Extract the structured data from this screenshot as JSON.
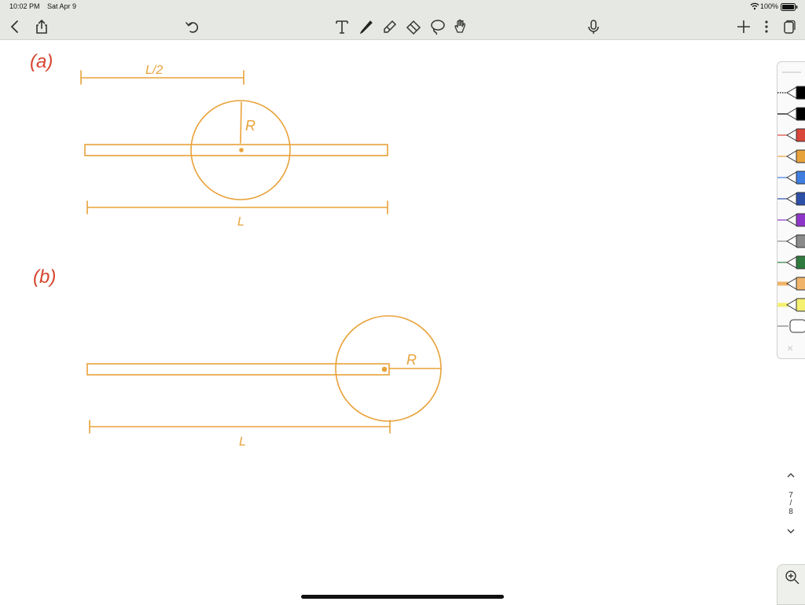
{
  "status": {
    "time": "10:02 PM",
    "date": "Sat Apr 9",
    "battery": "100%"
  },
  "toolbar": {
    "left": [
      "back-icon",
      "share-icon",
      "undo-icon"
    ],
    "tools": [
      "text-tool-icon",
      "pen-tool-icon",
      "highlighter-tool-icon",
      "eraser-tool-icon",
      "lasso-tool-icon",
      "hand-tool-icon"
    ],
    "center": [
      "microphone-icon"
    ],
    "right": [
      "add-icon",
      "more-icon",
      "pages-icon"
    ]
  },
  "note": {
    "part_a_label": "(a)",
    "half_length_label": "L/2",
    "radius_label_a": "R",
    "length_label_a": "L",
    "part_b_label": "(b)",
    "radius_label_b": "R",
    "length_label_b": "L"
  },
  "colors": {
    "ink_orange": "#e8a23a",
    "ink_red": "#d6452f",
    "toolbar_bg": "#e6e9e3"
  },
  "pen_palette": [
    {
      "name": "pen-black-dotted",
      "color": "#000000"
    },
    {
      "name": "pen-black",
      "color": "#000000"
    },
    {
      "name": "pen-red",
      "color": "#d9463a"
    },
    {
      "name": "pen-orange",
      "color": "#e8a23a"
    },
    {
      "name": "pen-blue",
      "color": "#3f7de0"
    },
    {
      "name": "pen-dark-blue",
      "color": "#2c4fa8"
    },
    {
      "name": "pen-purple",
      "color": "#8e35c9"
    },
    {
      "name": "pen-gray",
      "color": "#8a8a8a"
    },
    {
      "name": "pen-green",
      "color": "#2f7a3e"
    },
    {
      "name": "highlighter-orange",
      "color": "#f0b46a"
    },
    {
      "name": "highlighter-yellow",
      "color": "#f5f070"
    },
    {
      "name": "eraser",
      "color": "#b0b0b0"
    }
  ],
  "pager": {
    "current": "7",
    "sep": "/",
    "total": "8"
  }
}
